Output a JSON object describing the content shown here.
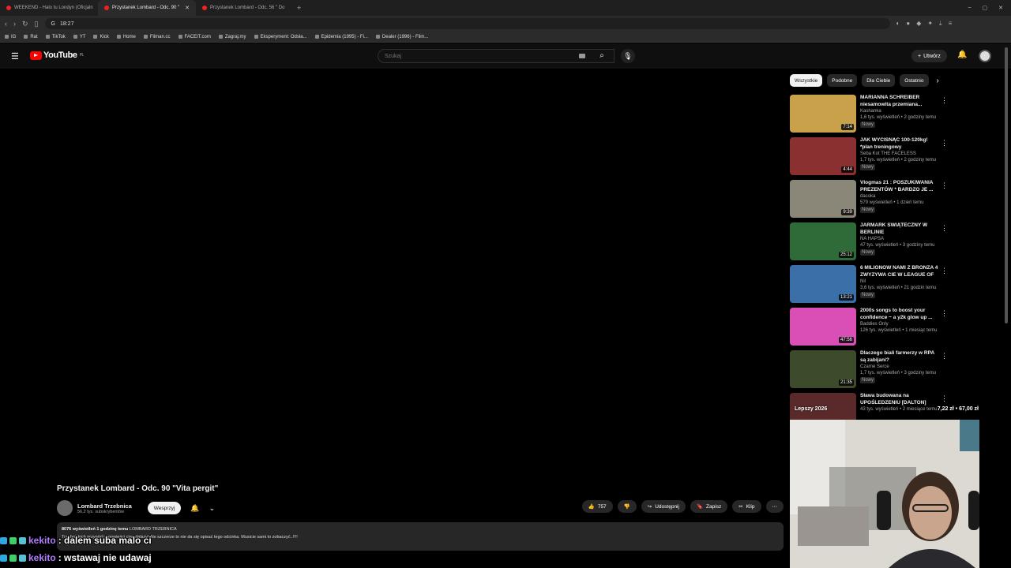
{
  "browser": {
    "tabs": [
      {
        "label": "WEEKEND - Halo tu Londyn (Oficjaln",
        "active": false
      },
      {
        "label": "Przystanek Lombard - Odc. 90 \"",
        "active": true
      },
      {
        "label": "Przystanek Lombard - Odc. 56 \" Do",
        "active": false
      }
    ],
    "address": "18:27",
    "bookmarks": [
      "IG",
      "Rat",
      "TikTok",
      "YT",
      "Kick",
      "Home",
      "Filman.cc",
      "FACEIT.com",
      "Zagraj.my",
      "Eksperyment: Odsła...",
      "Epidemia (1995) - Fi...",
      "Dealer (1996) - Film..."
    ]
  },
  "header": {
    "logo_text": "YouTube",
    "logo_region": "PL",
    "search_placeholder": "Szukaj",
    "create_label": "Utwórz"
  },
  "chips": [
    "Wszystkie",
    "Podobne",
    "Dla Ciebie",
    "Ostatnio"
  ],
  "recommendations": [
    {
      "title": "MARIANNA SCHREIBER niesamowita przemiana...",
      "channel": "Kashanka",
      "meta": "1,6 tys. wyświetleń • 2 godziny temu",
      "badge": "Nowy",
      "duration": "7:14",
      "color": "#c9a14a"
    },
    {
      "title": "JAK WYCISNĄĆ 100-120kg! *plan treningowy",
      "channel": "Seba Kot THE FACELESS",
      "meta": "1,7 tys. wyświetleń • 2 godziny temu",
      "badge": "Nowy",
      "duration": "4:44",
      "color": "#8a3030"
    },
    {
      "title": "Vlogmas 21 : POSZUKIWANIA PREZENTÓW * BARDZO JE ...",
      "channel": "dacoka",
      "meta": "579 wyświetleń • 1 dzień temu",
      "badge": "Nowy",
      "duration": "9:39",
      "color": "#8b8778"
    },
    {
      "title": "JARMARK ŚWIĄTECZNY W BERLINIE",
      "channel": "NA HAPSA",
      "meta": "47 tys. wyświetleń • 3 godziny temu",
      "badge": "Nowy",
      "duration": "25:12",
      "color": "#2f6b38"
    },
    {
      "title": "6 MILIONOW NAMI Z BRONZA 4 ZWYZYWA CIE W LEAGUE OF ...",
      "channel": "Nil",
      "meta": "3,6 tys. wyświetleń • 21 godzin temu",
      "badge": "Nowy",
      "duration": "13:21",
      "color": "#3b6fa8"
    },
    {
      "title": "2000s songs to boost your confidence ~ a y2k glow up ...",
      "channel": "Baddies Only",
      "meta": "126 tys. wyświetleń • 1 miesiąc temu",
      "badge": "",
      "duration": "47:56",
      "color": "#d94fb6"
    },
    {
      "title": "Dlaczego biali farmerzy w RPA są zabijani?",
      "channel": "Czarne Serce",
      "meta": "1,7 tys. wyświetleń • 3 godziny temu",
      "badge": "Nowy",
      "duration": "21:35",
      "color": "#3d4b2c"
    },
    {
      "title": "Sława budowana na UPOŚLEDZENIU [DALTON]",
      "channel": "",
      "meta": "43 tys. wyświetleń • 2 miesiące temu",
      "badge": "",
      "duration": "",
      "color": "#5a2a2a"
    }
  ],
  "video": {
    "title": "Przystanek Lombard - Odc. 90 \"Vita pergit\"",
    "channel": "Lombard Trzebnica",
    "subscribers": "56,2 tys. subskrybentów",
    "support_label": "Wesprzyj",
    "likes": "757",
    "share_label": "Udostępnij",
    "save_label": "Zapisz",
    "clip_label": "Klip",
    "views": "8076 wyświetleń  1 godzinę temu",
    "channel_tag": "LOMBARD TRZEBNICA",
    "description": "Trzebnickich przygód i opowieści ciąg dalszy! Ale szczerze to nie da się opisać tego odcinka. Musicie sami to zobaczyć..!!!!"
  },
  "overlay": {
    "budget_left": "Lepszy 2026",
    "budget_right": "7,22 zł • 67,00 zł"
  },
  "chat": [
    {
      "user": "kekito",
      "message": ": dalem suba malo ci"
    },
    {
      "user": "kekito",
      "message": ": wstawaj nie udawaj"
    }
  ]
}
